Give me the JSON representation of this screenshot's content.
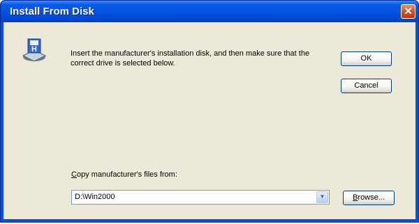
{
  "window": {
    "title": "Install From Disk",
    "close_glyph": "✕"
  },
  "dialog": {
    "icon": "floppy-install-disk-icon",
    "message": "Insert the manufacturer's installation disk, and then make sure that the correct drive is selected below.",
    "ok_label": "OK",
    "cancel_label": "Cancel",
    "copy_from_label_first": "C",
    "copy_from_label_rest": "opy manufacturer's files from:",
    "copy_from_value": "D:\\Win2000",
    "browse_label_first": "B",
    "browse_label_rest": "rowse..."
  },
  "colors": {
    "titlebar": "#0554e3",
    "client_bg": "#ece9d8",
    "close_button": "#d8451a"
  }
}
